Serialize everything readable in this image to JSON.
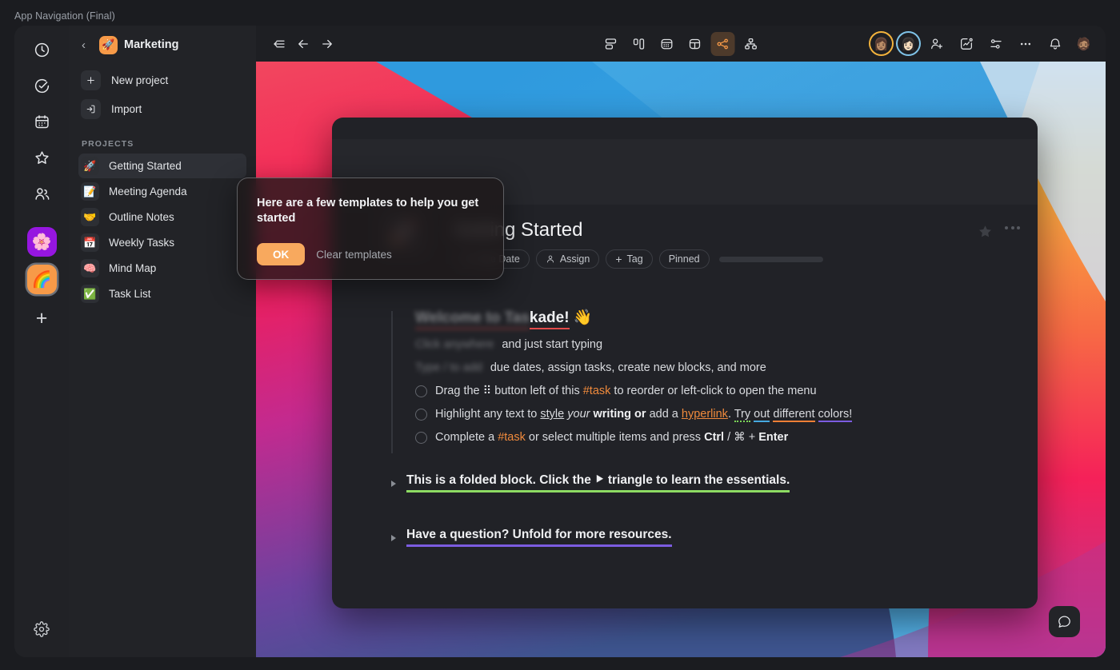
{
  "window": {
    "title": "App Navigation (Final)"
  },
  "rail": {
    "icons": [
      {
        "name": "clock-icon"
      },
      {
        "name": "check-circle-icon"
      },
      {
        "name": "calendar-icon"
      },
      {
        "name": "star-icon"
      },
      {
        "name": "people-icon"
      }
    ],
    "workspaces": [
      {
        "name": "workspace-flower",
        "emoji": "🌸",
        "color": "#9616e0",
        "selected": false
      },
      {
        "name": "workspace-rainbow",
        "emoji": "🌈",
        "color": "#f79a48",
        "selected": true
      }
    ],
    "add_label": "+",
    "settings_icon": "gear-icon"
  },
  "sidebar": {
    "back_label": "‹",
    "workspace_emoji": "🚀",
    "workspace_name": "Marketing",
    "actions": [
      {
        "label": "New project",
        "icon": "plus-icon"
      },
      {
        "label": "Import",
        "icon": "import-icon"
      }
    ],
    "section_label": "PROJECTS",
    "projects": [
      {
        "label": "Getting Started",
        "emoji": "🚀",
        "active": true
      },
      {
        "label": "Meeting Agenda",
        "emoji": "📝",
        "active": false
      },
      {
        "label": "Outline Notes",
        "emoji": "🤝",
        "active": false
      },
      {
        "label": "Weekly Tasks",
        "emoji": "📅",
        "active": false
      },
      {
        "label": "Mind Map",
        "emoji": "🧠",
        "active": false
      },
      {
        "label": "Task List",
        "emoji": "✅",
        "active": false
      }
    ]
  },
  "toolbar": {
    "left_icons": [
      {
        "name": "collapse-sidebar-icon"
      },
      {
        "name": "back-arrow-icon"
      },
      {
        "name": "forward-arrow-icon"
      }
    ],
    "view_icons": [
      {
        "name": "list-view-icon",
        "selected": false
      },
      {
        "name": "board-view-icon",
        "selected": false
      },
      {
        "name": "calendar-view-icon",
        "selected": false
      },
      {
        "name": "table-view-icon",
        "selected": false
      },
      {
        "name": "mindmap-view-icon",
        "selected": true
      },
      {
        "name": "org-chart-view-icon",
        "selected": false
      }
    ],
    "right_icons": [
      {
        "name": "avatar-member-1",
        "type": "avatar",
        "ring": "#f2b23c",
        "emoji": "👩🏽"
      },
      {
        "name": "avatar-member-2",
        "type": "avatar",
        "ring": "#7fc3e8",
        "emoji": "👩🏻"
      },
      {
        "name": "add-person-icon",
        "type": "icon"
      },
      {
        "name": "activity-chart-icon",
        "type": "icon"
      },
      {
        "name": "filter-settings-icon",
        "type": "icon"
      },
      {
        "name": "more-options-icon",
        "type": "icon"
      },
      {
        "name": "bell-notification-icon",
        "type": "icon"
      },
      {
        "name": "avatar-current-user",
        "type": "avatar",
        "ring": "none",
        "emoji": "🧔🏽"
      }
    ]
  },
  "document": {
    "emoji": "🚀",
    "title": "Getting Started",
    "star_icon": "star-filled-icon",
    "more_icon": "more-dots-icon",
    "chips": [
      {
        "label": "Due Date",
        "icon": "calendar-icon"
      },
      {
        "label": "Assign",
        "icon": "person-icon"
      },
      {
        "label": "Tag",
        "icon": "plus-icon"
      },
      {
        "label": "Pinned",
        "icon": "none"
      }
    ],
    "heading": {
      "prefix_hidden": "Welcome to Tas",
      "visible": "kade!",
      "emoji": "👋"
    },
    "lines": [
      {
        "id": "line-hidden-1",
        "hidden": "Click anywhere",
        "visible": "and just start typing"
      },
      {
        "id": "line-hidden-2",
        "hidden": "Type / to add",
        "visible": "due dates, assign tasks, create new blocks, and more"
      }
    ],
    "tasks": [
      {
        "id": "task-drag",
        "parts": [
          {
            "t": "Drag the ⠿ button left of this ",
            "s": "plain"
          },
          {
            "t": "#task",
            "s": "task"
          },
          {
            "t": " to reorder or left-click to open the menu",
            "s": "plain"
          }
        ]
      },
      {
        "id": "task-highlight",
        "parts": [
          {
            "t": "Highlight any text to ",
            "s": "plain"
          },
          {
            "t": "style",
            "s": "underline"
          },
          {
            "t": " ",
            "s": "plain"
          },
          {
            "t": "your",
            "s": "italic"
          },
          {
            "t": " ",
            "s": "plain"
          },
          {
            "t": "writing or",
            "s": "bold"
          },
          {
            "t": " add a ",
            "s": "plain"
          },
          {
            "t": "hyperlink",
            "s": "link"
          },
          {
            "t": ". ",
            "s": "plain"
          },
          {
            "t": "Try",
            "s": "hl-green"
          },
          {
            "t": " ",
            "s": "plain"
          },
          {
            "t": "out",
            "s": "hl-blue"
          },
          {
            "t": " ",
            "s": "plain"
          },
          {
            "t": "different",
            "s": "hl-orange"
          },
          {
            "t": " ",
            "s": "plain"
          },
          {
            "t": "colors!",
            "s": "hl-purple"
          }
        ]
      },
      {
        "id": "task-complete",
        "parts": [
          {
            "t": "Complete a ",
            "s": "plain"
          },
          {
            "t": "#task",
            "s": "task"
          },
          {
            "t": " or select multiple items and press ",
            "s": "plain"
          },
          {
            "t": "Ctrl",
            "s": "bold"
          },
          {
            "t": " / ",
            "s": "plain"
          },
          {
            "t": "⌘",
            "s": "plain"
          },
          {
            "t": " + ",
            "s": "plain"
          },
          {
            "t": "Enter",
            "s": "bold"
          }
        ]
      }
    ],
    "folded_blocks": [
      {
        "id": "folded-essentials",
        "text": "This is a folded block. Click the ⯈ triangle to learn the essentials.",
        "underline": "#8ddc63"
      },
      {
        "id": "folded-resources",
        "text": "Have a question? Unfold for more resources.",
        "underline": "#7b5ce0"
      }
    ]
  },
  "popover": {
    "title": "Here are a few templates to help you get started",
    "ok_label": "OK",
    "clear_label": "Clear templates",
    "accent": "#f8a95e"
  },
  "chat": {
    "icon": "chat-bubble-icon"
  },
  "colors": {
    "accent_orange": "#f79a48",
    "task_orange": "#f08a3c",
    "highlight_green": "#7bd659",
    "highlight_blue": "#46a9e0",
    "highlight_orange": "#ef7f36",
    "highlight_purple": "#7b5ce0",
    "heading_underline_red": "#e34b4b",
    "shell_bg": "#222327",
    "canvas_bg": "#1e1f23",
    "card_bg": "#212227"
  }
}
